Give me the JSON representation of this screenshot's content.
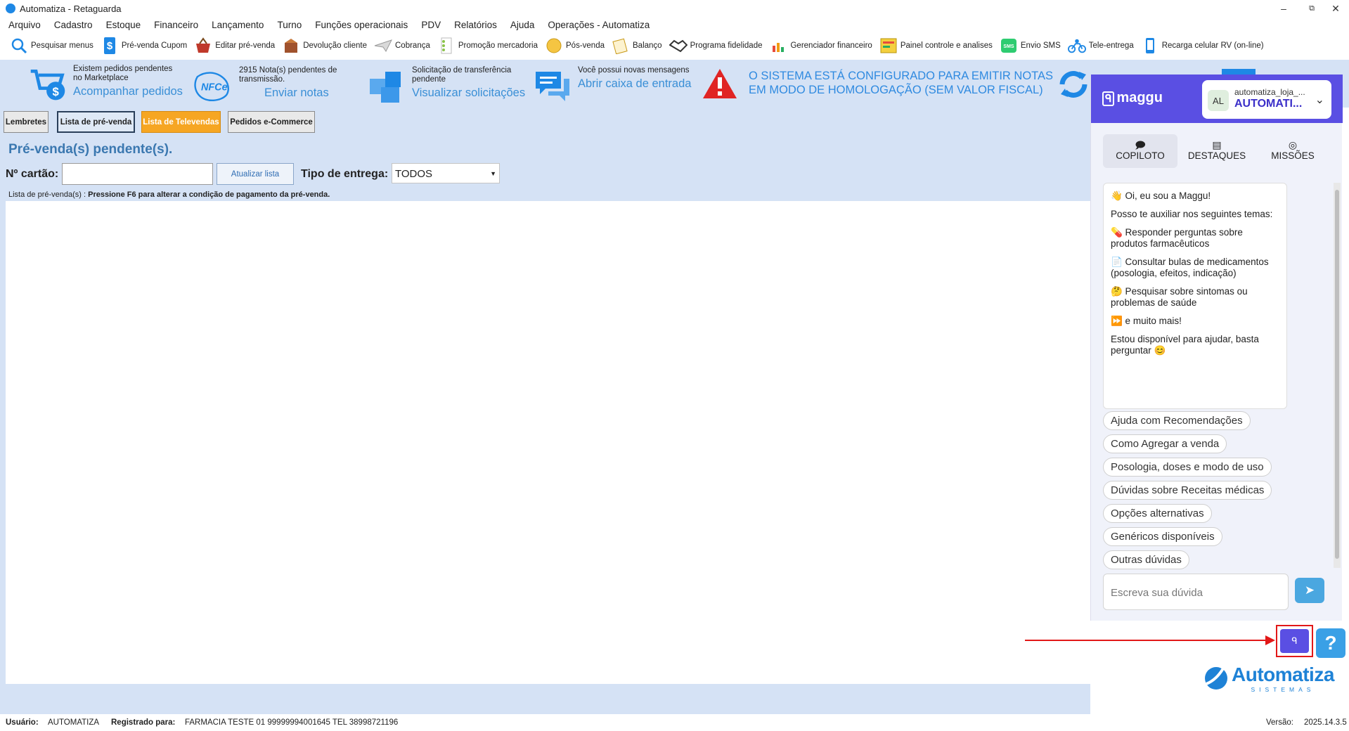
{
  "window": {
    "title": "Automatiza - Retaguarda",
    "minimize": "–",
    "restore": "⧉",
    "close": "✕"
  },
  "menu": [
    "Arquivo",
    "Cadastro",
    "Estoque",
    "Financeiro",
    "Lançamento",
    "Turno",
    "Funções operacionais",
    "PDV",
    "Relatórios",
    "Ajuda",
    "Operações - Automatiza"
  ],
  "toolbar": [
    {
      "label": "Pesquisar menus",
      "icon": "magnifier-icon"
    },
    {
      "label": "Pré-venda Cupom",
      "icon": "dollar-tag-icon"
    },
    {
      "label": "Editar pré-venda",
      "icon": "basket-icon"
    },
    {
      "label": "Devolução cliente",
      "icon": "return-box-icon"
    },
    {
      "label": "Cobrança",
      "icon": "paper-plane-icon"
    },
    {
      "label": "Promoção mercadoria",
      "icon": "promo-list-icon"
    },
    {
      "label": "Pós-venda",
      "icon": "coin-icon"
    },
    {
      "label": "Balanço",
      "icon": "pencil-note-icon"
    },
    {
      "label": "Programa fidelidade",
      "icon": "handshake-icon"
    },
    {
      "label": "Gerenciador financeiro",
      "icon": "bar-chart-icon"
    },
    {
      "label": "Painel controle e analises",
      "icon": "dashboard-icon"
    },
    {
      "label": "Envio SMS",
      "icon": "sms-icon"
    },
    {
      "label": "Tele-entrega",
      "icon": "motorbike-icon"
    },
    {
      "label": "Recarga celular RV (on-line)",
      "icon": "cellphone-icon"
    }
  ],
  "banner": {
    "marketplace": {
      "text": "Existem pedidos pendentes no Marketplace",
      "link": "Acompanhar pedidos"
    },
    "nfce": {
      "text": "2915 Nota(s) pendentes de transmissão.",
      "link": "Enviar notas",
      "icon_text": "NFCe"
    },
    "transfer": {
      "text": "Solicitação de transferência pendente",
      "link": "Visualizar solicitações"
    },
    "messages": {
      "text": "Você possui novas mensagens",
      "link": "Abrir caixa de entrada"
    },
    "warning": {
      "line1": "O SISTEMA ESTÁ CONFIGURADO PARA EMITIR NOTAS",
      "line2": "EM MODO DE HOMOLOGAÇÃO (SEM VALOR FISCAL)"
    }
  },
  "tabs": [
    "Lembretes",
    "Lista de pré-venda",
    "Lista de Televendas",
    "Pedidos e-Commerce"
  ],
  "main": {
    "title": "Pré-venda(s) pendente(s).",
    "card_label": "Nº cartão:",
    "card_value": "",
    "update_button": "Atualizar lista",
    "delivery_label": "Tipo de entrega:",
    "delivery_value": "TODOS",
    "hint_prefix": "Lista de pré-venda(s) : ",
    "hint_bold": "Pressione F6 para alterar a condição de pagamento da pré-venda."
  },
  "status": {
    "user_label": "Usuário:",
    "user_value": "AUTOMATIZA",
    "reg_label": "Registrado para:",
    "reg_value": "FARMACIA TESTE 01 99999994001645 TEL 38998721196",
    "version_label": "Versão:",
    "version_value": "2025.14.3.5"
  },
  "maggu": {
    "logo": "maggu",
    "account": {
      "avatar": "AL",
      "user": "automatiza_loja_...",
      "name": "AUTOMATI..."
    },
    "tabs": [
      {
        "label": "COPILOTO",
        "icon": "chat-icon",
        "active": true
      },
      {
        "label": "DESTAQUES",
        "icon": "newspaper-icon",
        "active": false
      },
      {
        "label": "MISSÕES",
        "icon": "target-icon",
        "active": false
      }
    ],
    "message": [
      "👋 Oi, eu sou a Maggu!",
      "Posso te auxiliar nos seguintes temas:",
      "💊 Responder perguntas sobre produtos farmacêuticos",
      "📄 Consultar bulas de medicamentos (posologia, efeitos, indicação)",
      "🤔 Pesquisar sobre sintomas ou problemas de saúde",
      "⏩ e muito mais!",
      "Estou disponível para ajudar, basta perguntar 😊"
    ],
    "chips": [
      "Ajuda com Recomendações",
      "Como Agregar a venda",
      "Posologia, doses e modo de uso",
      "Dúvidas sobre Receitas médicas",
      "Opções alternativas",
      "Genéricos disponíveis",
      "Outras dúvidas"
    ],
    "input_placeholder": "Escreva sua dúvida",
    "send_icon": "send-icon"
  },
  "bottom": {
    "help": "?",
    "brand": "Automatiza",
    "brand_sub": "SISTEMAS"
  },
  "colors": {
    "accent": "#5a4fe3",
    "banner_bg": "#d5e2f5",
    "link": "#3a8fd6",
    "highlight": "#e21818",
    "televendas": "#f6a623"
  }
}
